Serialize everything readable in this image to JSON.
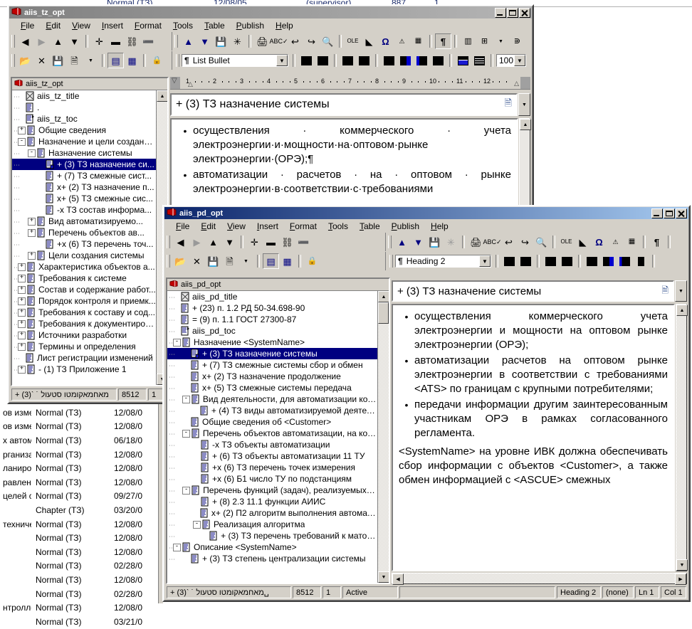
{
  "background": {
    "top_strip": [
      {
        "c1": "Normal (ТЗ)",
        "c2": "12/08/05",
        "c3": "(supervisor)",
        "c4": "887",
        "c5": "1"
      }
    ],
    "columns": [
      "name",
      "style",
      "date"
    ],
    "rows": [
      {
        "name": "ов измер",
        "style": "Normal (ТЗ)",
        "date": "12/08/0"
      },
      {
        "name": "ов измер",
        "style": "Normal (ТЗ)",
        "date": "12/08/0"
      },
      {
        "name": "х автома",
        "style": "Normal (ТЗ)",
        "date": "06/18/0"
      },
      {
        "name": "рганизац",
        "style": "Normal (ТЗ)",
        "date": "12/08/0"
      },
      {
        "name": "ланирова",
        "style": "Normal (ТЗ)",
        "date": "12/08/0"
      },
      {
        "name": "равлени",
        "style": "Normal (ТЗ)",
        "date": "12/08/0"
      },
      {
        "name": "целей со",
        "style": "Normal (ТЗ)",
        "date": "09/27/0"
      },
      {
        "name": "",
        "style": "Chapter (ТЗ)",
        "date": "03/20/0"
      },
      {
        "name": "техниче",
        "style": "Normal (ТЗ)",
        "date": "12/08/0"
      },
      {
        "name": "",
        "style": "Normal (ТЗ)",
        "date": "12/08/0"
      },
      {
        "name": "",
        "style": "Normal (ТЗ)",
        "date": "12/08/0"
      },
      {
        "name": "",
        "style": "Normal (ТЗ)",
        "date": "02/28/0"
      },
      {
        "name": "",
        "style": "Normal (ТЗ)",
        "date": "12/08/0"
      },
      {
        "name": "",
        "style": "Normal (ТЗ)",
        "date": "02/28/0"
      },
      {
        "name": "нтроллер",
        "style": "Normal (ТЗ)",
        "date": "12/08/0"
      },
      {
        "name": "",
        "style": "Normal (ТЗ)",
        "date": "03/21/0"
      }
    ]
  },
  "window1": {
    "title": "aiis_tz_opt",
    "active": false,
    "menu": [
      "File",
      "Edit",
      "View",
      "Insert",
      "Format",
      "Tools",
      "Table",
      "Publish",
      "Help"
    ],
    "nav_toolbar": [
      "back-arrow",
      "forward-arrow",
      "up-arrow",
      "down-arrow",
      "plus",
      "minus",
      "promote",
      "demote"
    ],
    "file_toolbar": [
      "open-folder",
      "delete-x",
      "save-disk",
      "new-doc",
      "dropdown-arrow",
      "outline-view",
      "table-view",
      "lock"
    ],
    "edit_toolbar": [
      "move-up",
      "move-down",
      "save",
      "magic-wand",
      "print",
      "spellcheck",
      "undo",
      "redo",
      "find",
      "ole-insert",
      "object",
      "omega-symbol",
      "symbol-alt",
      "grid",
      "pilcrow",
      "table",
      "table-grid",
      "table-dropdown",
      "indent"
    ],
    "style_label": "List Bullet",
    "zoom_value": "100",
    "tree_header": "aiis_tz_opt",
    "tree": [
      {
        "depth": 1,
        "exp": "",
        "icon": "doc-title-icon",
        "label": "aiis_tz_title",
        "sel": false
      },
      {
        "depth": 1,
        "exp": "",
        "icon": "doc-icon",
        "label": ".",
        "sel": false
      },
      {
        "depth": 1,
        "exp": "",
        "icon": "doc-toc-icon",
        "label": "aiis_tz_toc",
        "sel": false
      },
      {
        "depth": 1,
        "exp": "+",
        "icon": "doc-icon",
        "label": "Общие сведения",
        "sel": false
      },
      {
        "depth": 1,
        "exp": "-",
        "icon": "doc-icon",
        "label": "Назначение и цели создани...",
        "sel": false
      },
      {
        "depth": 2,
        "exp": "-",
        "icon": "doc-icon",
        "label": "Назначение системы",
        "sel": false
      },
      {
        "depth": 3,
        "exp": "",
        "icon": "doc-edit-icon",
        "label": "+ (3) ТЗ назначение си...",
        "sel": true
      },
      {
        "depth": 3,
        "exp": "",
        "icon": "doc-icon",
        "label": "+ (7) ТЗ смежные сист...",
        "sel": false
      },
      {
        "depth": 3,
        "exp": "",
        "icon": "doc-icon",
        "label": "х+ (2) ТЗ назначение п...",
        "sel": false
      },
      {
        "depth": 3,
        "exp": "",
        "icon": "doc-icon",
        "label": "х+ (5) ТЗ смежные сис...",
        "sel": false
      },
      {
        "depth": 3,
        "exp": "",
        "icon": "doc-icon",
        "label": "-х ТЗ состав информа...",
        "sel": false
      },
      {
        "depth": 2,
        "exp": "+",
        "icon": "doc-icon",
        "label": "Вид автоматизируемо...",
        "sel": false
      },
      {
        "depth": 2,
        "exp": "+",
        "icon": "doc-icon",
        "label": "Перечень объектов ав...",
        "sel": false
      },
      {
        "depth": 3,
        "exp": "",
        "icon": "doc-icon",
        "label": "+х (6) ТЗ перечень точ...",
        "sel": false
      },
      {
        "depth": 2,
        "exp": "+",
        "icon": "doc-icon",
        "label": "Цели создания системы",
        "sel": false
      },
      {
        "depth": 1,
        "exp": "+",
        "icon": "doc-icon",
        "label": "Характеристика объектов а...",
        "sel": false
      },
      {
        "depth": 1,
        "exp": "+",
        "icon": "doc-icon",
        "label": "Требования к системе",
        "sel": false
      },
      {
        "depth": 1,
        "exp": "+",
        "icon": "doc-icon",
        "label": "Состав и содержание работ...",
        "sel": false
      },
      {
        "depth": 1,
        "exp": "+",
        "icon": "doc-icon",
        "label": "Порядок контроля и приемк...",
        "sel": false
      },
      {
        "depth": 1,
        "exp": "+",
        "icon": "doc-icon",
        "label": "Требования к составу и сод...",
        "sel": false
      },
      {
        "depth": 1,
        "exp": "+",
        "icon": "doc-icon",
        "label": "Требования к документиров...",
        "sel": false
      },
      {
        "depth": 1,
        "exp": "+",
        "icon": "doc-icon",
        "label": "Источники разработки",
        "sel": false
      },
      {
        "depth": 1,
        "exp": "+",
        "icon": "doc-icon",
        "label": "Термины и определения",
        "sel": false
      },
      {
        "depth": 1,
        "exp": "",
        "icon": "doc-icon",
        "label": "Лист регистрации изменений",
        "sel": false
      },
      {
        "depth": 1,
        "exp": "+",
        "icon": "doc-icon",
        "label": "- (1) ТЗ Приложение 1",
        "sel": false
      }
    ],
    "doc_header": "+ (3) ТЗ назначение системы",
    "doc_bullets": [
      "осуществления · коммерческого · учета электроэнергии·и·мощности·на·оптовом·рынке электроэнергии·(ОРЭ);¶",
      "автоматизации · расчетов · на · оптовом · рынке электроэнергии·в·соответствии·с·требованиями"
    ],
    "status": {
      "doc": "+ (3)ˋ ˙ מאחמאקומטו סטעול",
      "size": "8512",
      "rev": "1"
    },
    "ruler_numbers": [
      "1",
      "2",
      "3",
      "4",
      "5",
      "6",
      "7",
      "8",
      "9",
      "10",
      "11",
      "12"
    ]
  },
  "window2": {
    "title": "aiis_pd_opt",
    "active": true,
    "menu": [
      "File",
      "Edit",
      "View",
      "Insert",
      "Format",
      "Tools",
      "Table",
      "Publish",
      "Help"
    ],
    "style_label": "Heading 2",
    "tree_header": "aiis_pd_opt",
    "tree": [
      {
        "depth": 1,
        "exp": "",
        "icon": "doc-title-icon",
        "label": "aiis_pd_title",
        "sel": false
      },
      {
        "depth": 1,
        "exp": "",
        "icon": "doc-icon",
        "label": "+ (23) п. 1.2 РД 50-34.698-90",
        "sel": false
      },
      {
        "depth": 1,
        "exp": "",
        "icon": "doc-icon",
        "label": "= (9) п. 1.1 ГОСТ 27300-87",
        "sel": false
      },
      {
        "depth": 1,
        "exp": "",
        "icon": "doc-toc-icon",
        "label": "aiis_pd_toc",
        "sel": false
      },
      {
        "depth": 1,
        "exp": "-",
        "icon": "doc-icon",
        "label": "Назначение <SystemName>",
        "sel": false
      },
      {
        "depth": 2,
        "exp": "",
        "icon": "doc-edit-icon",
        "label": "+ (3) ТЗ назначение системы",
        "sel": true
      },
      {
        "depth": 2,
        "exp": "",
        "icon": "doc-icon",
        "label": "+ (7) ТЗ смежные системы сбор и обмен",
        "sel": false
      },
      {
        "depth": 2,
        "exp": "",
        "icon": "doc-icon",
        "label": "х+ (2) ТЗ назначение продолжение",
        "sel": false
      },
      {
        "depth": 2,
        "exp": "",
        "icon": "doc-icon",
        "label": "х+ (5) ТЗ смежные системы передача",
        "sel": false
      },
      {
        "depth": 2,
        "exp": "-",
        "icon": "doc-icon",
        "label": "Вид деятельности, для автоматизации котор...",
        "sel": false
      },
      {
        "depth": 3,
        "exp": "",
        "icon": "doc-icon",
        "label": "+ (4) ТЗ виды автоматизируемой деятель...",
        "sel": false
      },
      {
        "depth": 2,
        "exp": "",
        "icon": "doc-icon",
        "label": "Общие сведения об <Customer>",
        "sel": false
      },
      {
        "depth": 2,
        "exp": "-",
        "icon": "doc-icon",
        "label": "Перечень объектов автоматизации, на котор...",
        "sel": false
      },
      {
        "depth": 3,
        "exp": "",
        "icon": "doc-icon",
        "label": "-х ТЗ объекты автоматизации",
        "sel": false
      },
      {
        "depth": 3,
        "exp": "",
        "icon": "doc-icon",
        "label": "+ (6) ТЗ объекты автоматизации 11 ТУ",
        "sel": false
      },
      {
        "depth": 3,
        "exp": "",
        "icon": "doc-icon",
        "label": "+х (6) ТЗ перечень точек измерения",
        "sel": false
      },
      {
        "depth": 3,
        "exp": "",
        "icon": "doc-icon",
        "label": "+х (6) Б1 число ТУ по подстанциям",
        "sel": false
      },
      {
        "depth": 2,
        "exp": "-",
        "icon": "doc-icon",
        "label": "Перечень функций (задач), реализуемых си...",
        "sel": false
      },
      {
        "depth": 3,
        "exp": "",
        "icon": "doc-icon",
        "label": "+ (8) 2.3 11.1 функции АИИС",
        "sel": false
      },
      {
        "depth": 3,
        "exp": "",
        "icon": "doc-icon",
        "label": "х+ (2) П2 алгоритм выполнения автомати...",
        "sel": false
      },
      {
        "depth": 3,
        "exp": "-",
        "icon": "doc-icon",
        "label": "Реализация алгоритма",
        "sel": false
      },
      {
        "depth": 4,
        "exp": "",
        "icon": "doc-icon",
        "label": "+ (3) ТЗ перечень требований к матобе...",
        "sel": false
      },
      {
        "depth": 1,
        "exp": "-",
        "icon": "doc-icon",
        "label": "Описание <SystemName>",
        "sel": false
      },
      {
        "depth": 2,
        "exp": "",
        "icon": "doc-icon",
        "label": "+ (3) ТЗ степень централизации системы",
        "sel": false
      }
    ],
    "doc_header": "+ (3) ТЗ назначение системы",
    "doc_bullets": [
      "осуществления коммерческого учета электроэнергии и мощности на оптовом рынке электроэнергии (ОРЭ);",
      "автоматизации расчетов на оптовом рынке электроэнергии в соответствии с требованиями <ATS> по границам с крупными потребителями;",
      "передачи информации другим заинтересованным участникам ОРЭ в рамках согласованного регламента."
    ],
    "doc_paragraph": "<SystemName> на уровне ИВК должна обеспечивать сбор информации с объектов <Customer>, а также обмен информацией с <ASCUE> смежных",
    "status": {
      "doc": "+ (3)ˋ ˙ מאחמאקומטו סטעול␣",
      "size": "8512",
      "rev": "1",
      "state": "Active",
      "style": "Heading 2",
      "lang": "(none)",
      "line": "Ln 1",
      "col": "Col 1"
    }
  },
  "colors": {
    "chrome": "#d4d0c8",
    "active_title": "#0a246a",
    "inactive_title": "#808080",
    "selection": "#000080",
    "icon_blue": "#000080"
  }
}
